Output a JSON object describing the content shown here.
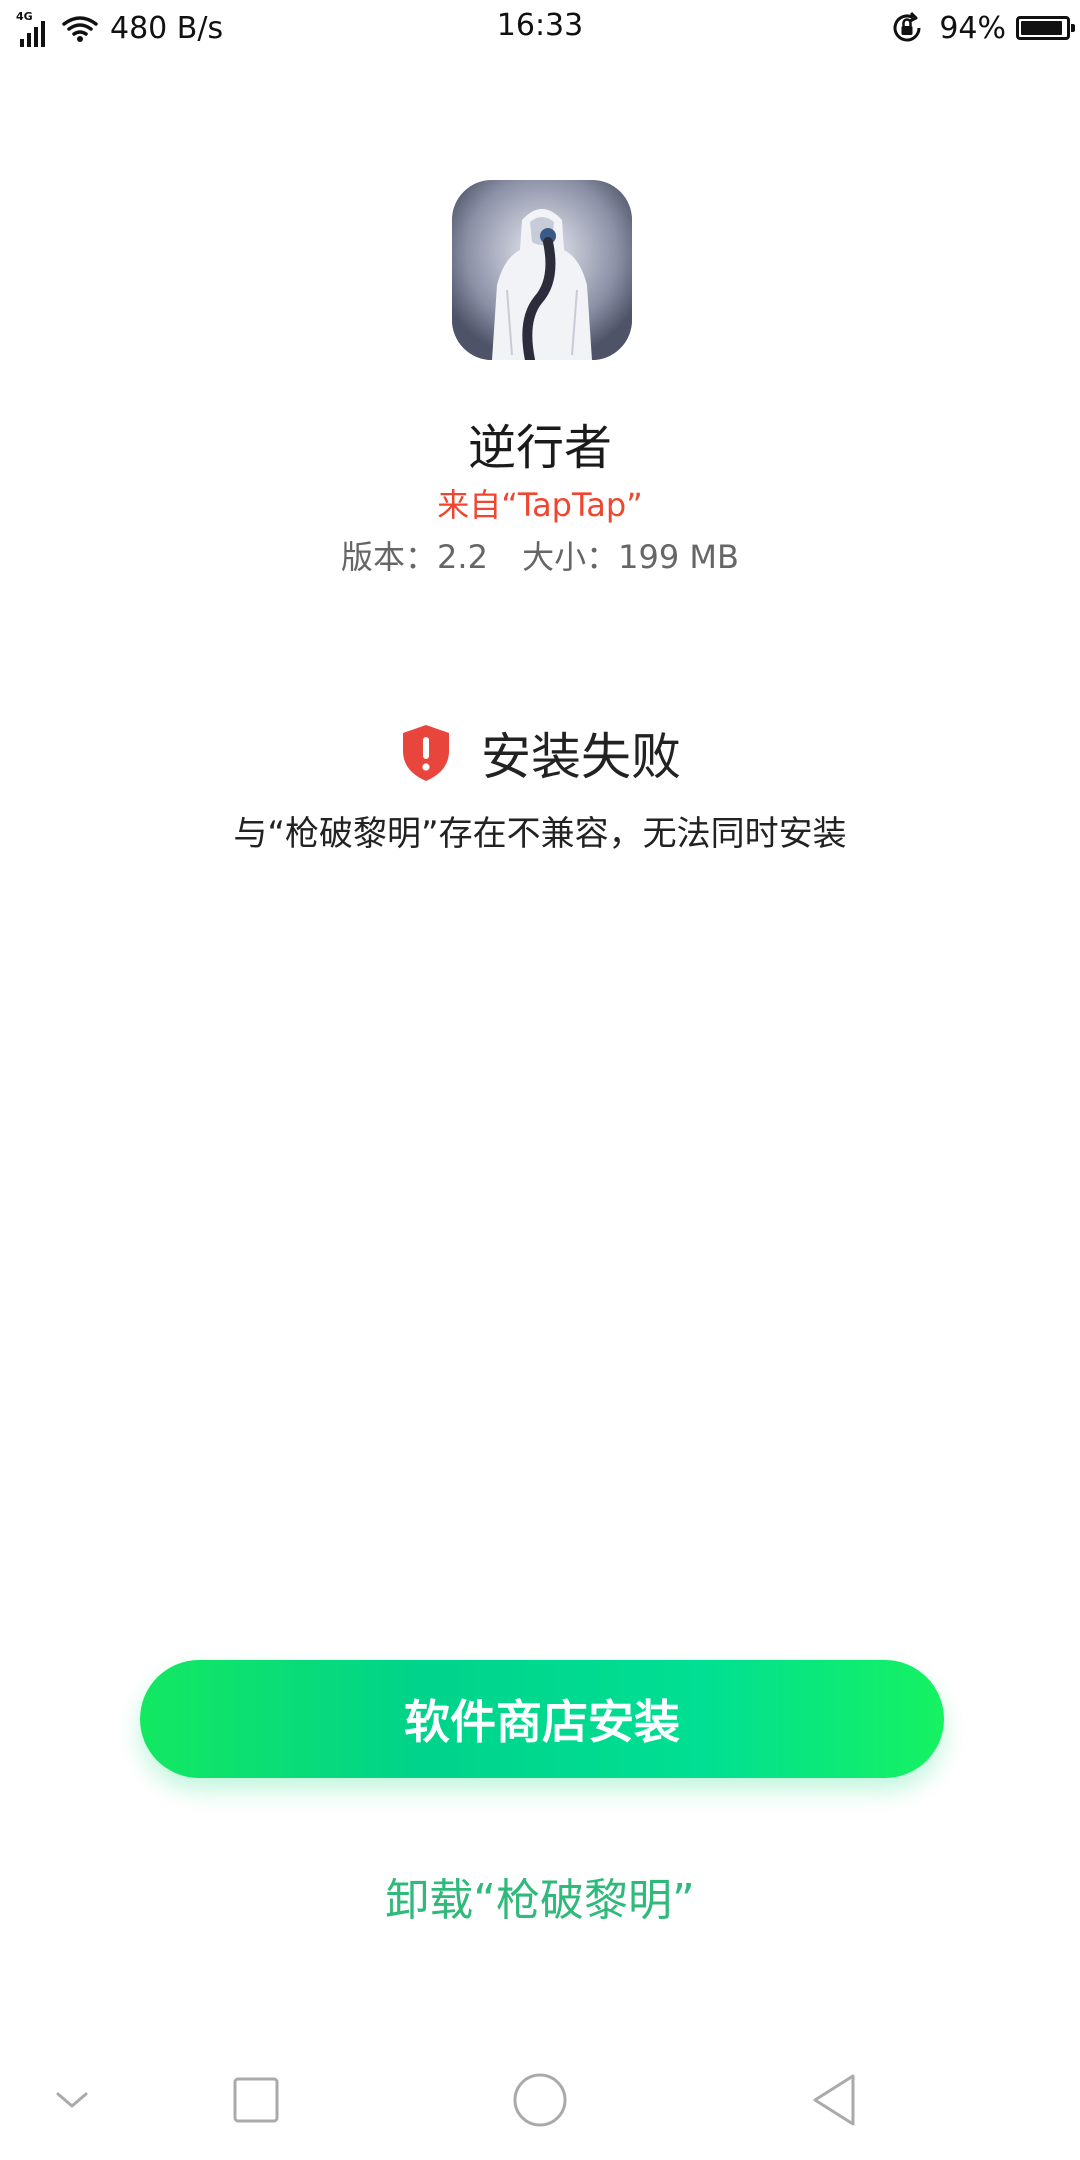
{
  "status_bar": {
    "network_type": "4G",
    "speed": "480 B/s",
    "time": "16:33",
    "battery_percent": "94%",
    "battery_level": 0.94,
    "icons": [
      "signal-icon",
      "wifi-icon",
      "rotation-lock-icon",
      "battery-icon"
    ]
  },
  "app": {
    "name": "逆行者",
    "source": "来自“TapTap”",
    "version": "版本：2.2",
    "size": "大小：199 MB"
  },
  "install_result": {
    "title": "安装失败",
    "message": "与“枪破黎明”存在不兼容，无法同时安装",
    "icon": "shield-alert-icon",
    "icon_color": "#e8453c"
  },
  "actions": {
    "store_install_label": "软件商店安装",
    "uninstall_label": "卸载“枪破黎明”"
  },
  "nav_bar": {
    "icons": [
      "chevron-down-icon",
      "recent-apps-icon",
      "home-icon",
      "back-icon"
    ]
  },
  "colors": {
    "accent_green": "#00d38b",
    "link_green": "#2fb97a",
    "source_red": "#f0462f"
  }
}
